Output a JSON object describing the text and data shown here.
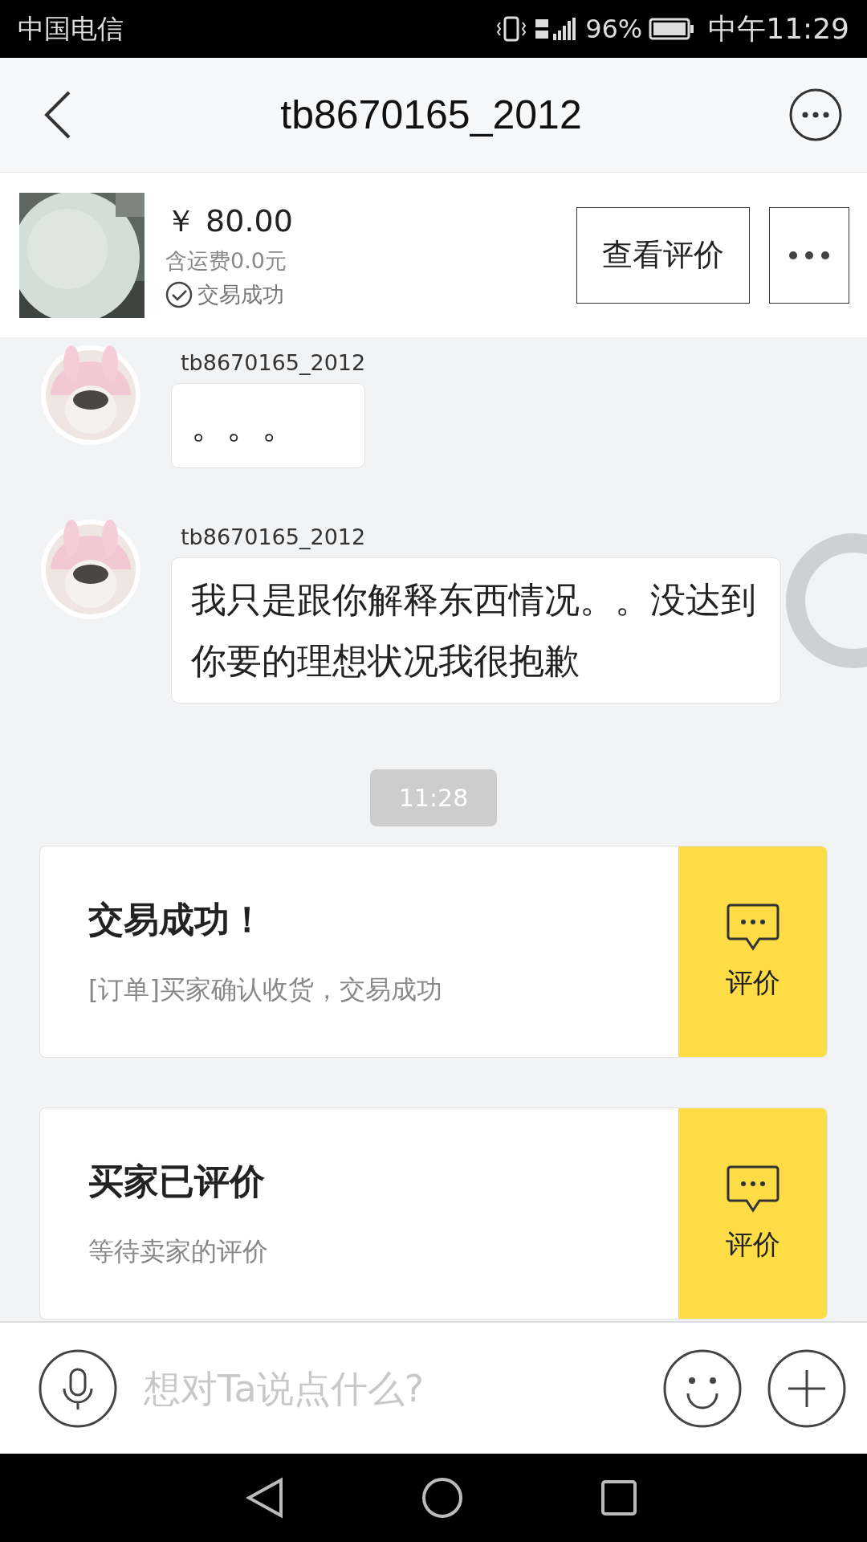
{
  "status_bar": {
    "carrier": "中国电信",
    "battery": "96%",
    "time": "中午11:29"
  },
  "header": {
    "title": "tb8670165_2012"
  },
  "product": {
    "price": "￥ 80.00",
    "shipping": "含运费0.0元",
    "status": "交易成功",
    "review_button": "查看评价"
  },
  "messages": [
    {
      "sender": "tb8670165_2012",
      "text": "。。。"
    },
    {
      "sender": "tb8670165_2012",
      "text": "我只是跟你解释东西情况。。没达到你要的理想状况我很抱歉"
    }
  ],
  "timestamp": "11:28",
  "cards": [
    {
      "title": "交易成功！",
      "subtitle": "[订单]买家确认收货，交易成功",
      "action": "评价"
    },
    {
      "title": "买家已评价",
      "subtitle": "等待卖家的评价",
      "action": "评价"
    }
  ],
  "input": {
    "placeholder": "想对Ta说点什么?"
  }
}
